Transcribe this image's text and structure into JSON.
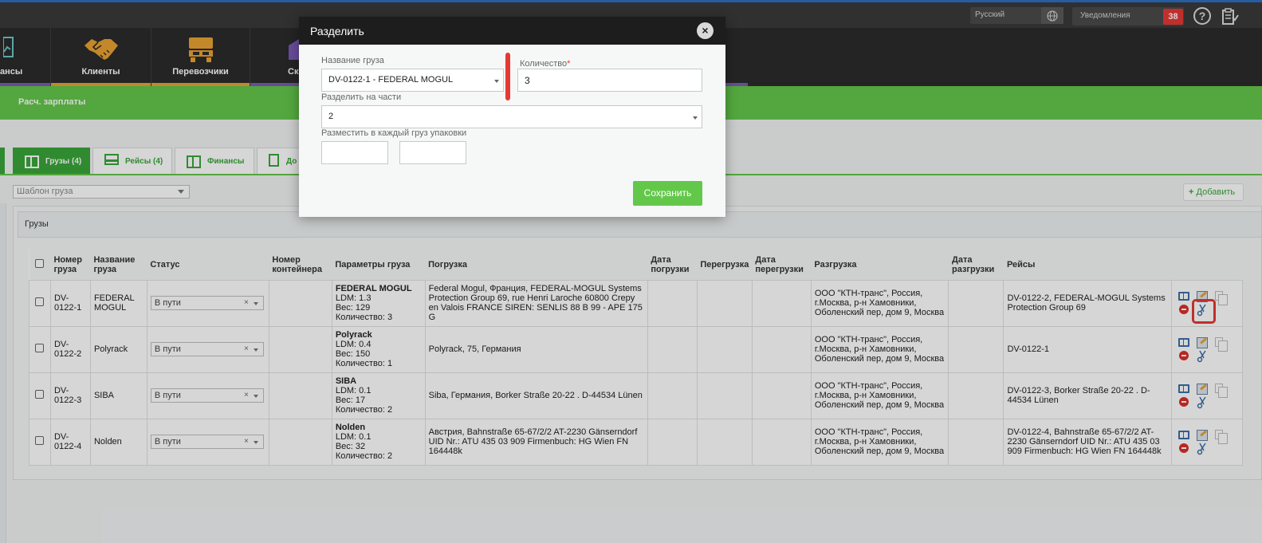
{
  "topbar": {
    "language": "Русский",
    "notifications_label": "Уведомления",
    "notifications_count": "38",
    "help": "?"
  },
  "nav": {
    "items": [
      {
        "label": "ансы",
        "color": "#7b5bb5"
      },
      {
        "label": "Клиенты",
        "color": "#e9a232"
      },
      {
        "label": "Перевозчики",
        "color": "#e9a232"
      },
      {
        "label": "Ск",
        "color": "#7b5bb5"
      }
    ]
  },
  "subnav": {
    "label": "Расч. зарплаты"
  },
  "tabs": [
    {
      "label": "Грузы (4)"
    },
    {
      "label": "Рейсы (4)"
    },
    {
      "label": "Финансы"
    },
    {
      "label": "До"
    }
  ],
  "toolbar": {
    "template_placeholder": "Шаблон груза",
    "add_label": "Добавить"
  },
  "panel": {
    "title": "Грузы"
  },
  "table": {
    "headers": [
      "Номер груза",
      "Название груза",
      "Статус",
      "Номер контейнера",
      "Параметры груза",
      "Погрузка",
      "Дата погрузки",
      "Перегрузка",
      "Дата перегрузки",
      "Разгрузка",
      "Дата разгрузки",
      "Рейсы"
    ],
    "rows": [
      {
        "number": "DV-0122-1",
        "name": "FEDERAL MOGUL",
        "status": "В пути",
        "container": "",
        "param_name": "FEDERAL MOGUL",
        "ldm": "LDM: 1.3",
        "weight": "Вес: 129",
        "qty": "Количество: 3",
        "loading": "Federal Mogul, Франция, FEDERAL-MOGUL Systems Protection Group 69, rue Henri Laroche 60800 Crepy en Valois FRANCE SIREN: SENLIS 88 B 99 - APE 175 G",
        "unloading": "ООО \"КТН-транс\", Россия, г.Москва, р-н Хамовники, Оболенский пер, дом 9, Москва",
        "trips": "DV-0122-2, FEDERAL-MOGUL Systems Protection Group 69"
      },
      {
        "number": "DV-0122-2",
        "name": "Polyrack",
        "status": "В пути",
        "container": "",
        "param_name": "Polyrack",
        "ldm": "LDM: 0.4",
        "weight": "Вес: 150",
        "qty": "Количество: 1",
        "loading": "Polyrack, 75, Германия",
        "unloading": "ООО \"КТН-транс\", Россия, г.Москва, р-н Хамовники, Оболенский пер, дом 9, Москва",
        "trips": "DV-0122-1"
      },
      {
        "number": "DV-0122-3",
        "name": "SIBA",
        "status": "В пути",
        "container": "",
        "param_name": "SIBA",
        "ldm": "LDM: 0.1",
        "weight": "Вес: 17",
        "qty": "Количество: 2",
        "loading": "Siba, Германия, Borker Straße 20-22 . D-44534 Lünen",
        "unloading": "ООО \"КТН-транс\", Россия, г.Москва, р-н Хамовники, Оболенский пер, дом 9, Москва",
        "trips": "DV-0122-3, Borker Straße 20-22 . D-44534 Lünen"
      },
      {
        "number": "DV-0122-4",
        "name": "Nolden",
        "status": "В пути",
        "container": "",
        "param_name": "Nolden",
        "ldm": "LDM: 0.1",
        "weight": "Вес: 32",
        "qty": "Количество: 2",
        "loading": "Австрия, Bahnstraße 65-67/2/2 AT-2230 Gänserndorf UID Nr.: ATU 435 03 909 Firmenbuch: HG Wien FN 164448k",
        "unloading": "ООО \"КТН-транс\", Россия, г.Москва, р-н Хамовники, Оболенский пер, дом 9, Москва",
        "trips": "DV-0122-4, Bahnstraße 65-67/2/2 AT-2230 Gänserndorf UID Nr.: ATU 435 03 909 Firmenbuch: HG Wien FN 164448k"
      }
    ]
  },
  "modal": {
    "title": "Разделить",
    "close": "×",
    "cargo_name_label": "Название груза",
    "cargo_name_value": "DV-0122-1 - FEDERAL MOGUL",
    "quantity_label": "Количество",
    "quantity_required": "*",
    "quantity_value": "3",
    "split_label": "Разделить на части",
    "split_value": "2",
    "packages_label": "Разместить в каждый груз упаковки",
    "package_1_value": "",
    "package_2_value": "",
    "save_label": "Сохранить"
  },
  "colors": {
    "green": "#63c84a",
    "dark_tab_green": "#3aa63a",
    "highlight_red": "#e53935",
    "top_stripe": "#2d6fc3"
  }
}
